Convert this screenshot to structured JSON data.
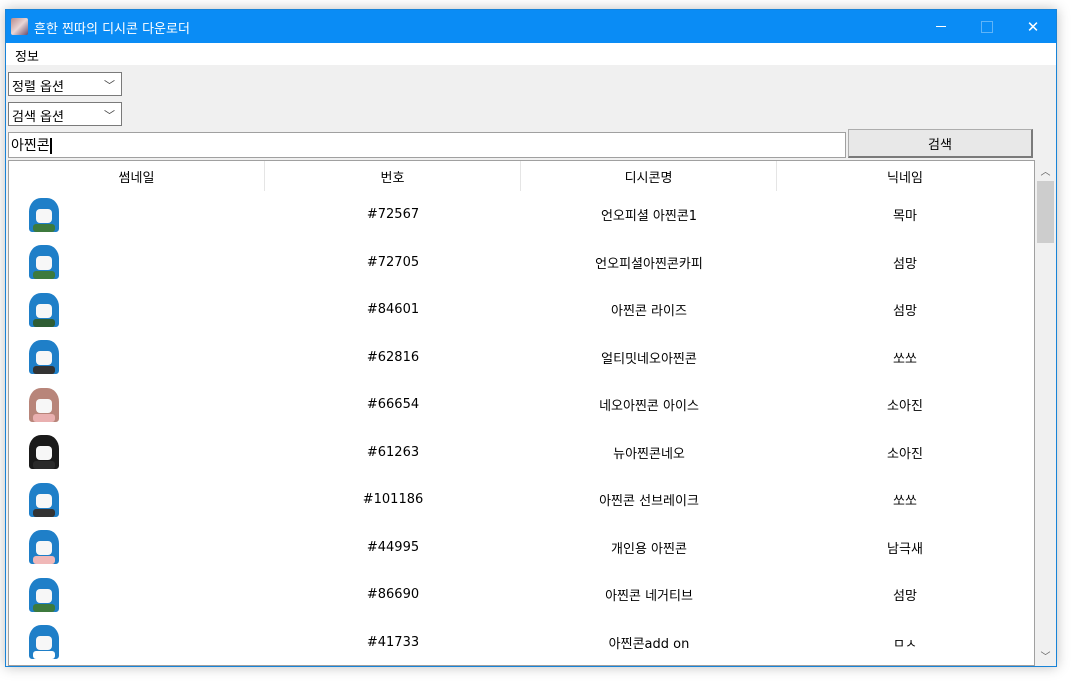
{
  "window": {
    "title": "흔한 찐따의 디시콘 다운로더",
    "controls": {
      "minimize": "minimize-icon",
      "maximize": "maximize-icon",
      "close": "close-icon"
    },
    "accent_color": "#0a8cf5"
  },
  "menubar": {
    "items": [
      {
        "label": "정보"
      }
    ]
  },
  "controls": {
    "sort_combo": {
      "value": "정렬 옵션"
    },
    "search_combo": {
      "value": "검색 옵션"
    },
    "search_input": {
      "value": "아찐콘"
    },
    "search_button": {
      "label": "검색"
    }
  },
  "table": {
    "columns": [
      "썸네일",
      "번호",
      "디시콘명",
      "닉네임"
    ],
    "rows": [
      {
        "thumb_hair": "#1f7fc8",
        "thumb_body": "#3d7a3d",
        "number": "#72567",
        "name": "언오피셜 아찐콘1",
        "nickname": "목마"
      },
      {
        "thumb_hair": "#1f7fc8",
        "thumb_body": "#3d7a3d",
        "number": "#72705",
        "name": "언오피셜아찐콘카피",
        "nickname": "섬망"
      },
      {
        "thumb_hair": "#1f7fc8",
        "thumb_body": "#2f5d34",
        "number": "#84601",
        "name": "아찐콘 라이즈",
        "nickname": "섬망"
      },
      {
        "thumb_hair": "#1f7fc8",
        "thumb_body": "#333333",
        "number": "#62816",
        "name": "얼티밋네오아찐콘",
        "nickname": "쏘쏘"
      },
      {
        "thumb_hair": "#b8857a",
        "thumb_body": "#e9b0b0",
        "number": "#66654",
        "name": "네오아찐콘 아이스",
        "nickname": "소아진"
      },
      {
        "thumb_hair": "#1a1a1a",
        "thumb_body": "#2a2a2a",
        "number": "#61263",
        "name": "뉴아찐콘네오",
        "nickname": "소아진"
      },
      {
        "thumb_hair": "#1f7fc8",
        "thumb_body": "#333333",
        "number": "#101186",
        "name": "아찐콘 선브레이크",
        "nickname": "쏘쏘"
      },
      {
        "thumb_hair": "#1f7fc8",
        "thumb_body": "#f0b8b8",
        "number": "#44995",
        "name": "개인용 아찐콘",
        "nickname": "남극새"
      },
      {
        "thumb_hair": "#1f7fc8",
        "thumb_body": "#3d7a3d",
        "number": "#86690",
        "name": "아찐콘 네거티브",
        "nickname": "섬망"
      },
      {
        "thumb_hair": "#1f7fc8",
        "thumb_body": "#ffffff",
        "number": "#41733",
        "name": "아찐콘add on",
        "nickname": "ㅁㅅ"
      }
    ]
  },
  "scrollbar": {
    "up": "chevron-up-icon",
    "down": "chevron-down-icon",
    "position": 0.0
  }
}
